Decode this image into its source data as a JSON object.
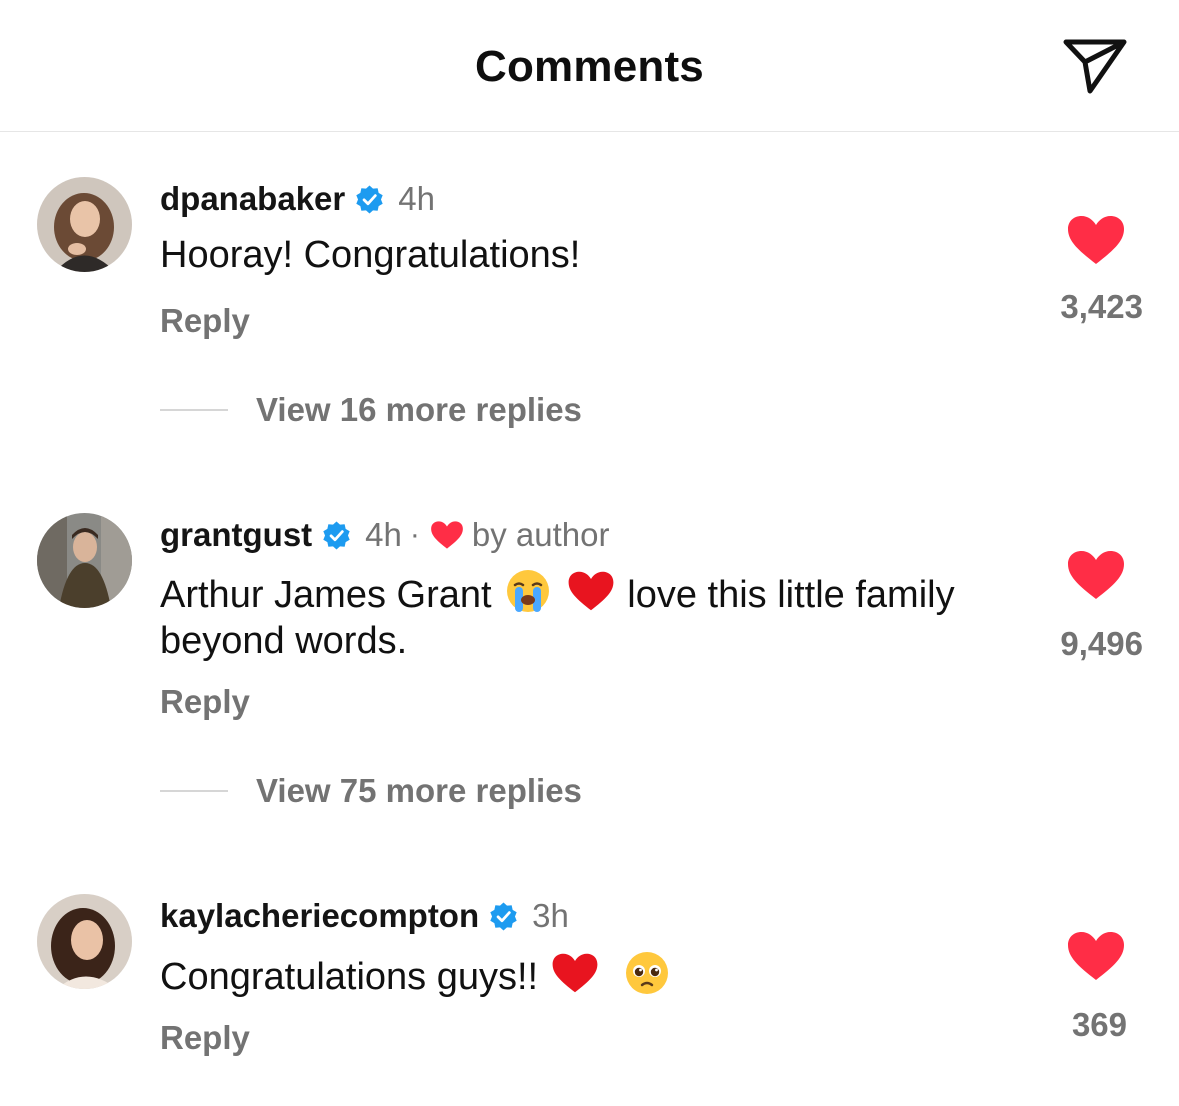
{
  "header": {
    "title": "Comments",
    "share_icon": "send-icon"
  },
  "colors": {
    "like_red": "#ff2d46",
    "verified_blue": "#1d9bf0",
    "secondary_text": "#737373"
  },
  "comments": [
    {
      "username": "dpanabaker",
      "verified": true,
      "time": "4h",
      "text": "Hooray! Congratulations!",
      "reply_label": "Reply",
      "likes": "3,423",
      "view_replies": "View 16 more replies"
    },
    {
      "username": "grantgust",
      "verified": true,
      "time": "4h",
      "separator": "·",
      "liked_by_author": "by author",
      "text_part1": "Arthur James Grant",
      "text_emojis": [
        "loudly-crying-face-emoji",
        "red-heart-emoji"
      ],
      "text_part2": "love this little family beyond words.",
      "reply_label": "Reply",
      "likes": "9,496",
      "view_replies": "View 75 more replies"
    },
    {
      "username": "kaylacheriecompton",
      "verified": true,
      "time": "3h",
      "text_part1": "Congratulations guys!!",
      "text_emojis": [
        "red-heart-emoji",
        "pleading-face-emoji"
      ],
      "reply_label": "Reply",
      "likes": "369"
    }
  ]
}
